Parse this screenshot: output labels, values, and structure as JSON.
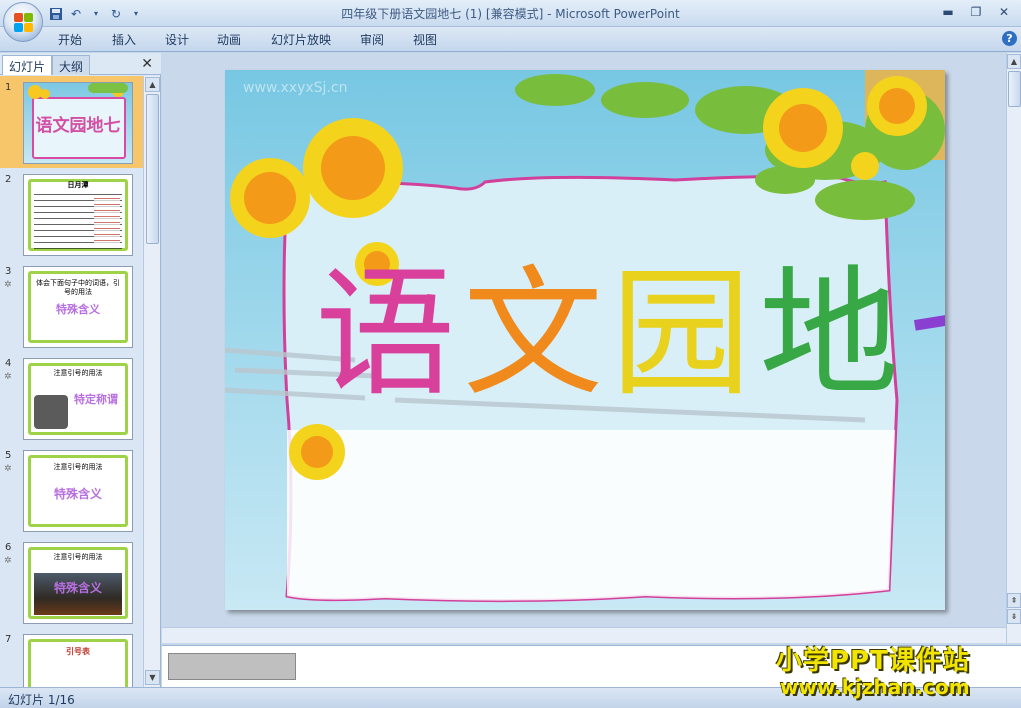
{
  "window": {
    "title": "四年级下册语文园地七 (1) [兼容模式] - Microsoft PowerPoint"
  },
  "ribbon": {
    "tabs": [
      "开始",
      "插入",
      "设计",
      "动画",
      "幻灯片放映",
      "审阅",
      "视图"
    ]
  },
  "panel": {
    "tab_slides": "幻灯片",
    "tab_outline": "大纲"
  },
  "thumbnails": [
    {
      "num": "1",
      "title": "语文园地七"
    },
    {
      "num": "2",
      "title": "日月潭"
    },
    {
      "num": "3",
      "title": "特殊含义",
      "text": "体会下面句子中的词语，引号的用法"
    },
    {
      "num": "4",
      "title": "特定称谓",
      "text": "注意引号的用法"
    },
    {
      "num": "5",
      "title": "特殊含义",
      "text": "注意引号的用法"
    },
    {
      "num": "6",
      "title": "特殊含义",
      "text": "注意引号的用法"
    },
    {
      "num": "7",
      "title": "引号表"
    }
  ],
  "slide": {
    "title_chars": [
      "语",
      "文",
      "园",
      "地",
      "七"
    ],
    "title_colors": [
      "#d9409c",
      "#f08a1c",
      "#e8d21d",
      "#37a845",
      "#8a3fd1"
    ],
    "watermark_url": "www.xxyxSj.cn"
  },
  "status": {
    "slide_counter": "幻灯片 1/16"
  },
  "watermark": {
    "line1": "小学PPT课件站",
    "line2": "www.kjzhan.com"
  }
}
